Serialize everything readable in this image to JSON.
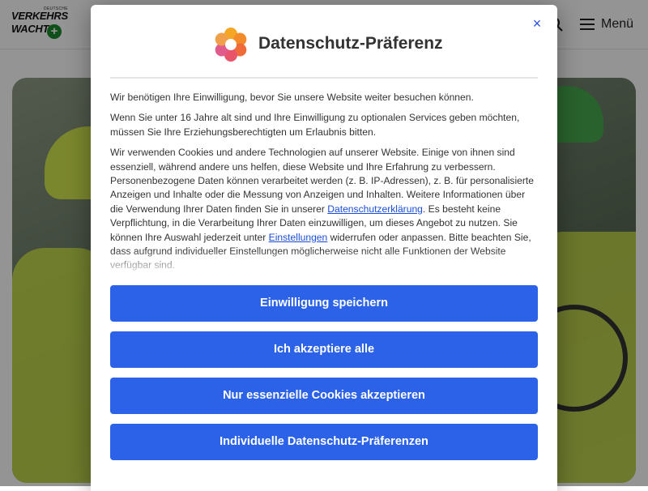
{
  "site": {
    "logo": {
      "sup": "DEUTSCHE",
      "line1": "VERKEHRS",
      "line2": "WACHT",
      "plus": "+"
    },
    "menu_label": "Menü"
  },
  "consent": {
    "title": "Datenschutz-Präferenz",
    "close_symbol": "×",
    "paragraph1": "Wir benötigen Ihre Einwilligung, bevor Sie unsere Website weiter besuchen können.",
    "paragraph2": "Wenn Sie unter 16 Jahre alt sind und Ihre Einwilligung zu optionalen Services geben möchten, müssen Sie Ihre Erziehungsberechtigten um Erlaubnis bitten.",
    "paragraph3": {
      "part1": "Wir verwenden Cookies und andere Technologien auf unserer Website. Einige von ihnen sind essenziell, während andere uns helfen, diese Website und Ihre Erfahrung zu verbessern. Personenbezogene Daten können verarbeitet werden (z. B. IP-Adressen), z. B. für personalisierte Anzeigen und Inhalte oder die Messung von Anzeigen und Inhalten. Weitere Informationen über die Verwendung Ihrer Daten finden Sie in unserer ",
      "link_privacy": "Datenschutzerklärung",
      "part2": ". Es besteht keine Verpflichtung, in die Verarbeitung Ihrer Daten einzuwilligen, um dieses Angebot zu nutzen. Sie können Ihre Auswahl jederzeit unter ",
      "link_settings": "Einstellungen",
      "part3": " widerrufen oder anpassen. Bitte beachten Sie, dass aufgrund individueller Einstellungen möglicherweise nicht alle Funktionen der Website verfügbar sind."
    },
    "buttons": {
      "save": "Einwilligung speichern",
      "accept_all": "Ich akzeptiere alle",
      "essential_only": "Nur essenzielle Cookies akzeptieren",
      "individual": "Individuelle Datenschutz-Präferenzen"
    }
  },
  "colors": {
    "primary_button": "#2b62e8",
    "link": "#1a4ed8",
    "logo_green": "#1a8a2e"
  },
  "icons": [
    "search-icon",
    "hamburger-icon",
    "close-icon",
    "privacy-brand-icon"
  ]
}
